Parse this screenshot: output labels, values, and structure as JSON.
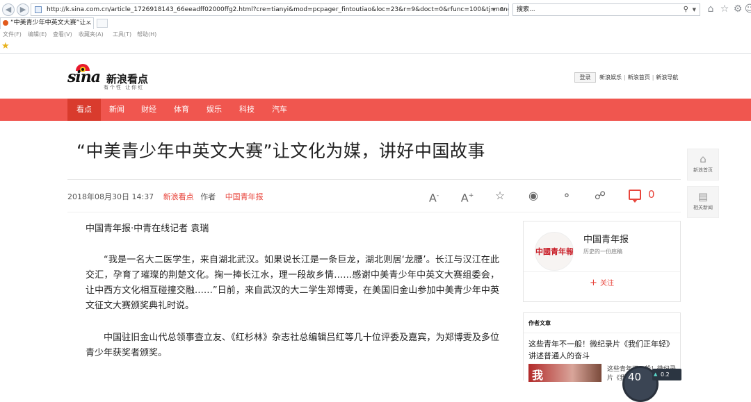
{
  "browser": {
    "url": "http://k.sina.com.cn/article_1726918143_66eeadff02000ffg2.html?cre=tianyi&mod=pcpager_fintoutiao&loc=23&r=9&doct=0&rfunc=100&tj=none&tr=",
    "search_placeholder": "搜索...",
    "tab_title": "“中美青少年中英文大赛”让...",
    "menu": [
      "文件(F)",
      "编辑(E)",
      "查看(V)",
      "收藏夹(A)",
      "工具(T)",
      "帮助(H)"
    ]
  },
  "header": {
    "logo_cn": "新浪看点",
    "logo_slogan": "有个性 让你红",
    "login": "登录",
    "links": [
      "新浪娱乐",
      "新浪首页",
      "新浪导航"
    ]
  },
  "nav": [
    "看点",
    "新闻",
    "财经",
    "体育",
    "娱乐",
    "科技",
    "汽车"
  ],
  "article": {
    "title": "“中美青少年中英文大赛”让文化为媒，讲好中国故事",
    "datetime": "2018年08月30日 14:37",
    "source": "新浪看点",
    "author_label": "作者",
    "author": "中国青年报",
    "comment_count": "0",
    "paragraphs": [
      "中国青年报·中青在线记者 袁瑞",
      "“我是一名大二医学生，来自湖北武汉。如果说长江是一条巨龙，湖北则居‘龙腰’。长江与汉江在此交汇，孕育了璀璨的荆楚文化。掬一捧长江水，理一段故乡情……感谢中美青少年中英文大赛组委会，让中西方文化相互碰撞交融……”日前，来自武汉的大二学生郑博雯，在美国旧金山参加中美青少年中英文征文大赛颁奖典礼时说。",
      "中国驻旧金山代总领事查立友、《红杉林》杂志社总编辑吕红等几十位评委及嘉宾，为郑博雯及多位青少年获奖者颁奖。"
    ]
  },
  "sidebar": {
    "profile_name": "中国青年报",
    "profile_desc": "历史的一份底稿",
    "avatar_text": "中國青年報",
    "follow": "关注",
    "authors_head": "作者文章",
    "article_title": "这些青年不一般！微纪录片《我们正年轻》讲述普通人的奋斗",
    "thumb_text": "我",
    "sub_title": "这些青年不一般！微纪录片《我"
  },
  "float": {
    "home": "新浪首页",
    "related": "相关新闻"
  },
  "speed": {
    "percent": "40",
    "rate": "0.2"
  }
}
